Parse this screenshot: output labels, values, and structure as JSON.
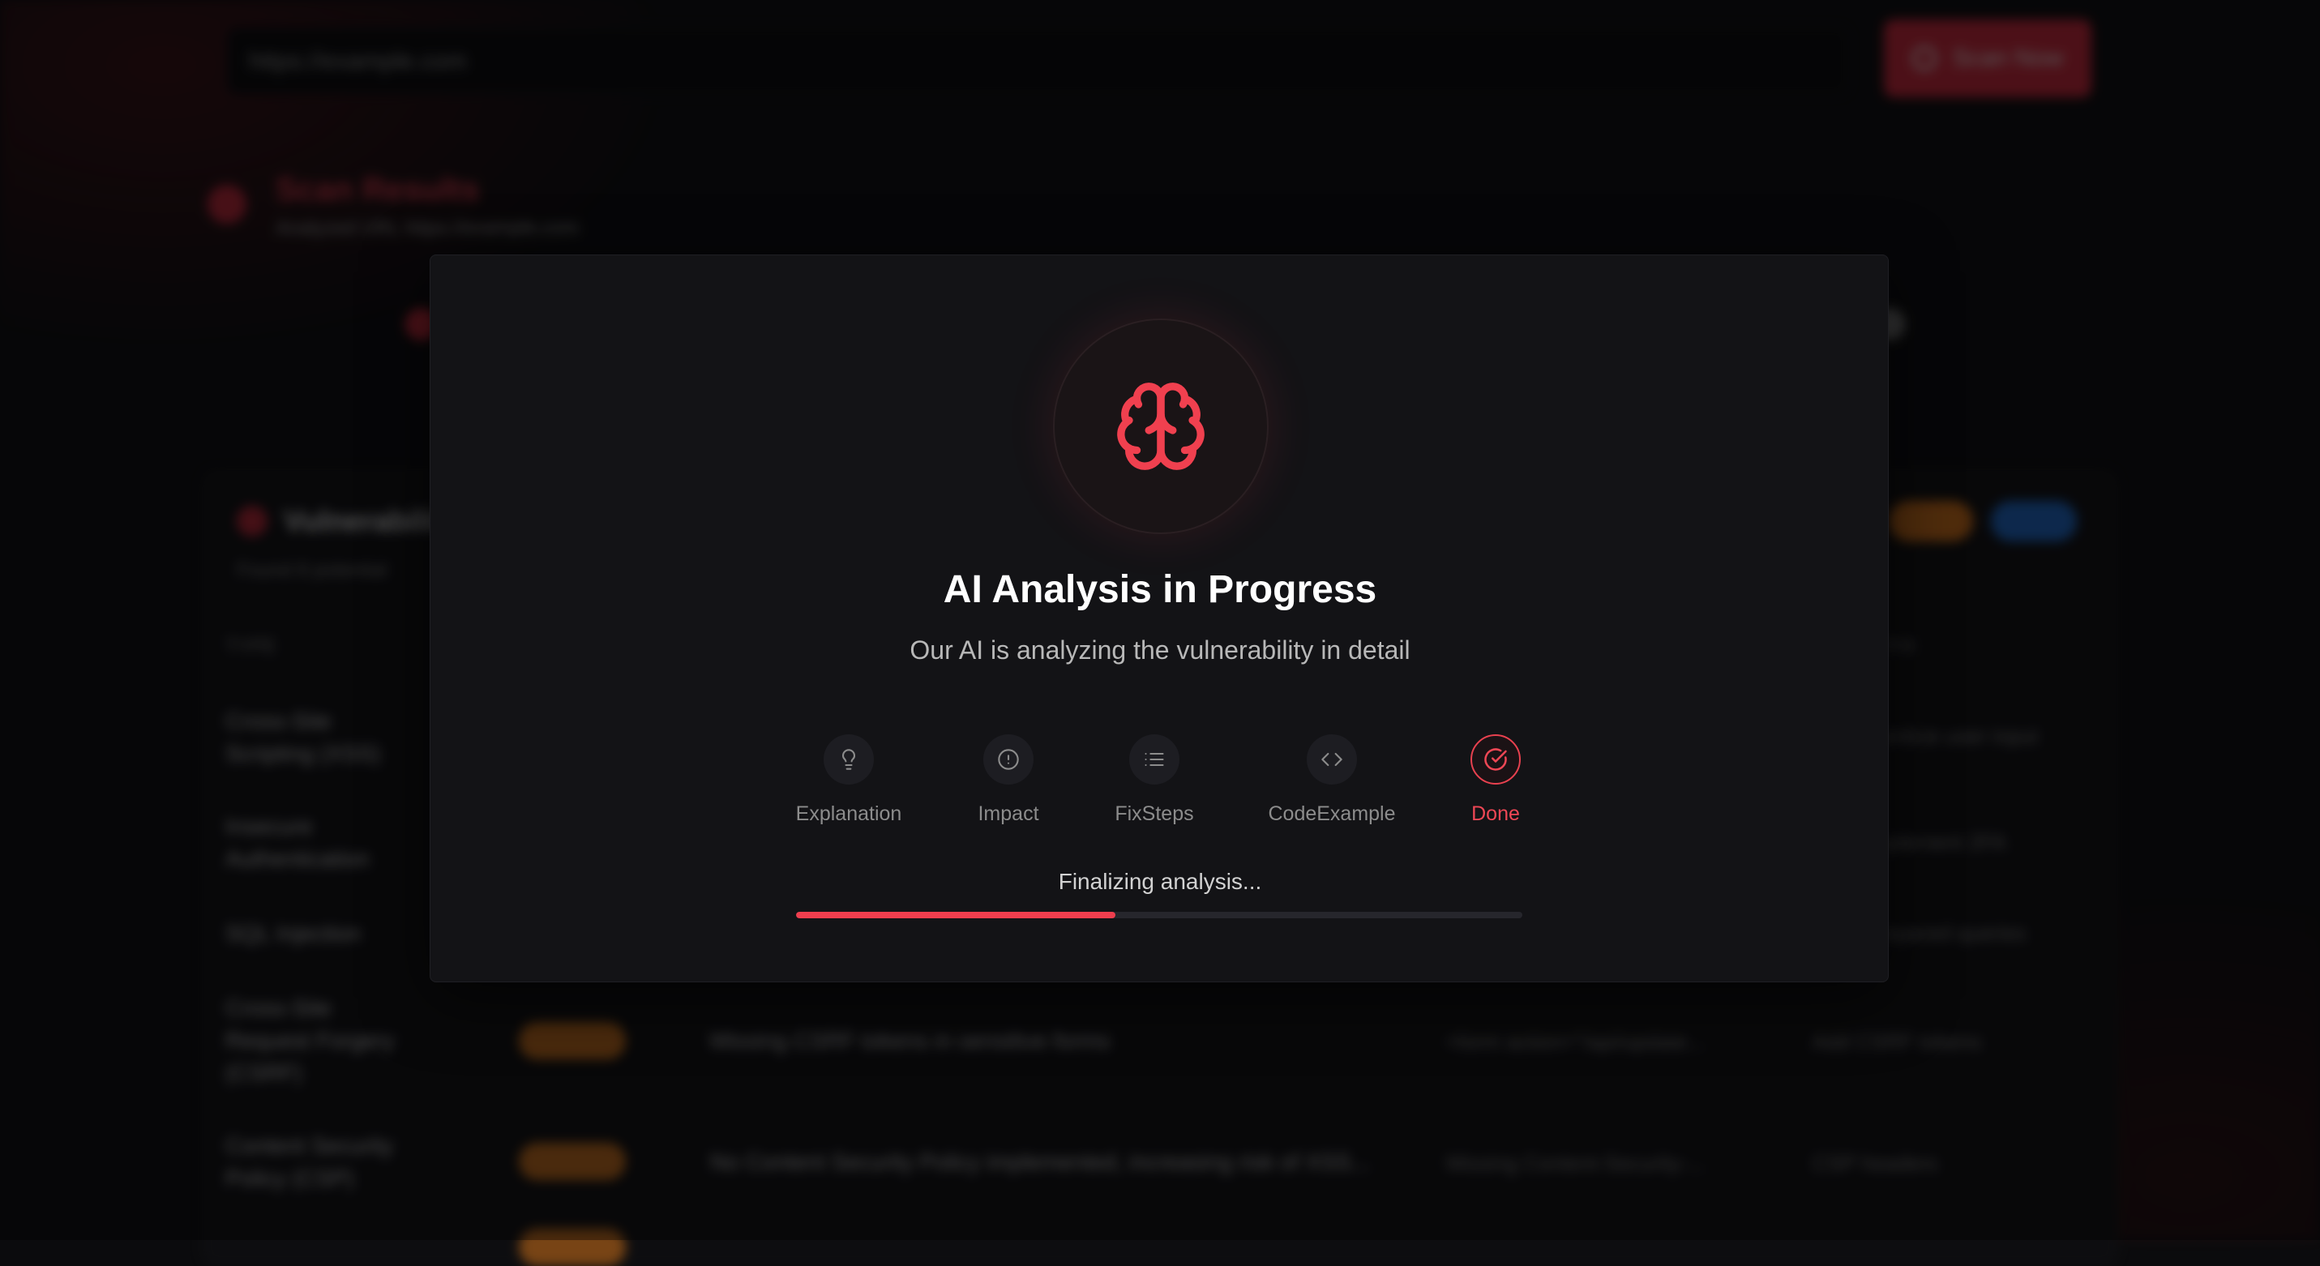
{
  "background": {
    "url_input": "https://example.com",
    "scan_button": "Scan Now",
    "results_title": "Scan Results",
    "results_subtitle": "Analyzed URL https://example.com",
    "vulnerabilities_title": "Vulnerabilities",
    "vulnerabilities_subtitle": "Found 8 potential",
    "column_type": "TYPE",
    "column_fix": "FIX",
    "rows": [
      {
        "type": "Cross-Site Scripting (XSS)",
        "severity": "",
        "description": "",
        "evidence": "",
        "fix": "Sanitize user input"
      },
      {
        "type": "Insecure Authentication",
        "severity": "",
        "description": "",
        "evidence": "",
        "fix": "Implement 2FA"
      },
      {
        "type": "SQL Injection",
        "severity": "",
        "description": "",
        "evidence": "",
        "fix": "Prepared queries"
      },
      {
        "type": "Cross-Site Request Forgery (CSRF)",
        "severity": "MEDIUM",
        "description": "Missing CSRF tokens in sensitive forms",
        "evidence": "<form action=\"/api/update...",
        "fix": "Add CSRF tokens"
      },
      {
        "type": "Content Security Policy (CSP)",
        "severity": "MEDIUM",
        "description": "No Content Security Policy implemented, increasing risk of XSS...",
        "evidence": "Missing Content-Security-...",
        "fix": "CSP headers"
      }
    ]
  },
  "modal": {
    "icon": "brain-icon",
    "title": "AI Analysis in Progress",
    "subtitle": "Our AI is analyzing the vulnerability in detail",
    "steps": [
      {
        "label": "Explanation",
        "icon": "lightbulb-icon",
        "state": "pending"
      },
      {
        "label": "Impact",
        "icon": "alert-circle-icon",
        "state": "pending"
      },
      {
        "label": "FixSteps",
        "icon": "list-icon",
        "state": "pending"
      },
      {
        "label": "CodeExample",
        "icon": "code-icon",
        "state": "pending"
      },
      {
        "label": "Done",
        "icon": "check-circle-icon",
        "state": "active"
      }
    ],
    "status_text": "Finalizing analysis...",
    "progress": 0.44
  },
  "colors": {
    "accent": "#ee3e4e",
    "background": "#0b0b0d",
    "modal_bg": "#131316",
    "muted_text": "#8c8c8c"
  }
}
